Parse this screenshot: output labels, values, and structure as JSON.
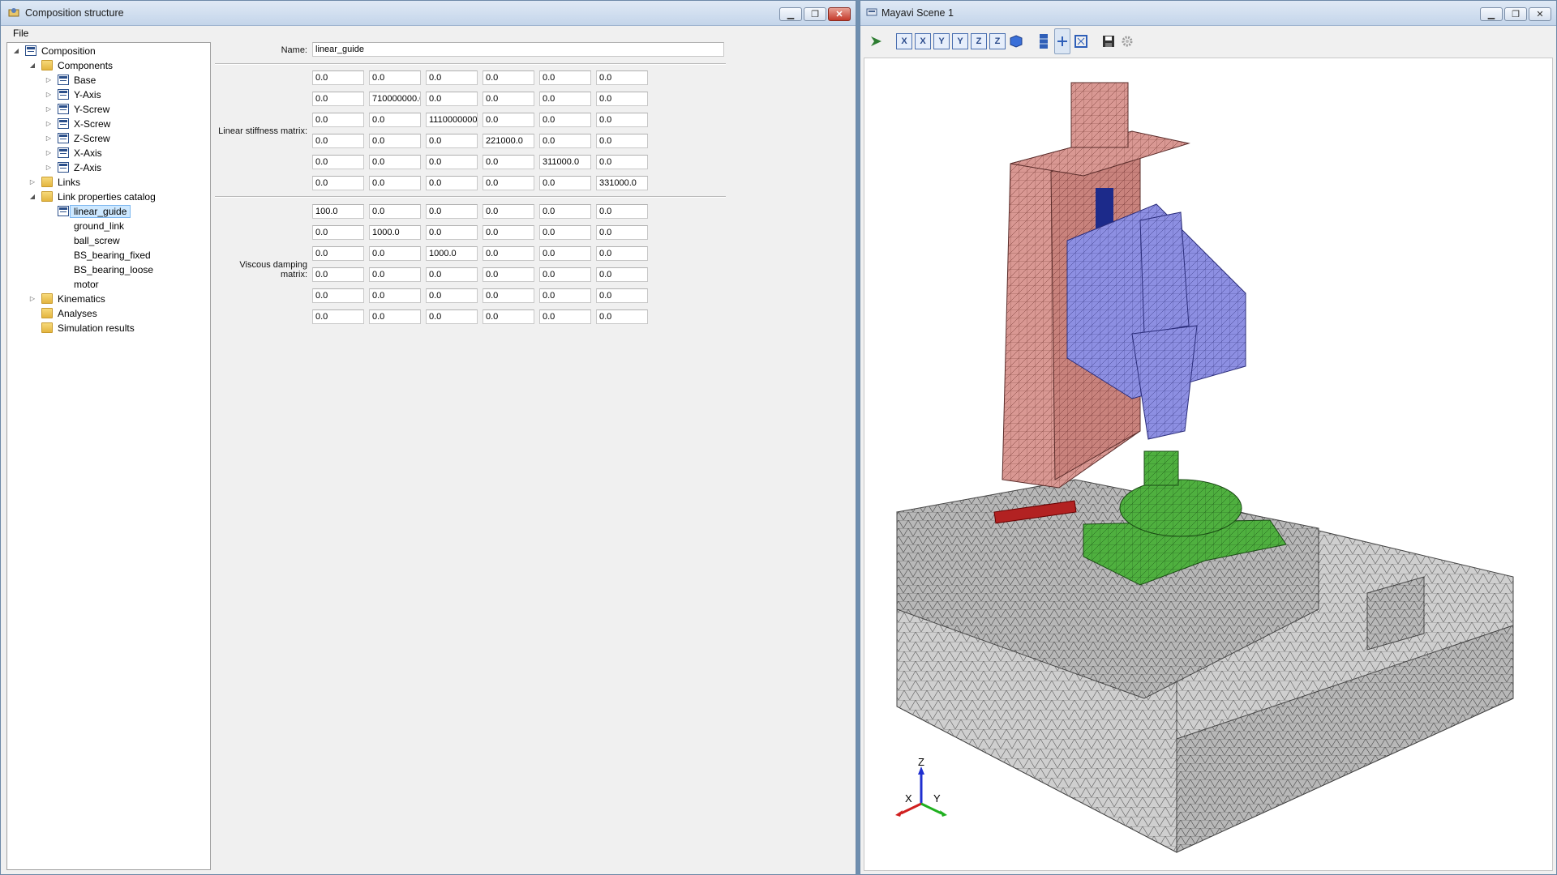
{
  "left_window": {
    "title": "Composition structure",
    "menu": {
      "file": "File"
    },
    "tree": {
      "root": "Composition",
      "components_folder": "Components",
      "components": [
        "Base",
        "Y-Axis",
        "Y-Screw",
        "X-Screw",
        "Z-Screw",
        "X-Axis",
        "Z-Axis"
      ],
      "links": "Links",
      "catalog_folder": "Link properties catalog",
      "catalog_items": [
        "linear_guide",
        "ground_link",
        "ball_screw",
        "BS_bearing_fixed",
        "BS_bearing_loose",
        "motor"
      ],
      "kinematics": "Kinematics",
      "analyses": "Analyses",
      "simulation_results": "Simulation results"
    },
    "form": {
      "name_label": "Name:",
      "name_value": "linear_guide",
      "stiffness_label": "Linear stiffness matrix:",
      "stiffness": [
        [
          "0.0",
          "0.0",
          "0.0",
          "0.0",
          "0.0",
          "0.0"
        ],
        [
          "0.0",
          "710000000.0",
          "0.0",
          "0.0",
          "0.0",
          "0.0"
        ],
        [
          "0.0",
          "0.0",
          "1110000000.0",
          "0.0",
          "0.0",
          "0.0"
        ],
        [
          "0.0",
          "0.0",
          "0.0",
          "221000.0",
          "0.0",
          "0.0"
        ],
        [
          "0.0",
          "0.0",
          "0.0",
          "0.0",
          "311000.0",
          "0.0"
        ],
        [
          "0.0",
          "0.0",
          "0.0",
          "0.0",
          "0.0",
          "331000.0"
        ]
      ],
      "damping_label": "Viscous damping matrix:",
      "damping": [
        [
          "100.0",
          "0.0",
          "0.0",
          "0.0",
          "0.0",
          "0.0"
        ],
        [
          "0.0",
          "1000.0",
          "0.0",
          "0.0",
          "0.0",
          "0.0"
        ],
        [
          "0.0",
          "0.0",
          "1000.0",
          "0.0",
          "0.0",
          "0.0"
        ],
        [
          "0.0",
          "0.0",
          "0.0",
          "0.0",
          "0.0",
          "0.0"
        ],
        [
          "0.0",
          "0.0",
          "0.0",
          "0.0",
          "0.0",
          "0.0"
        ],
        [
          "0.0",
          "0.0",
          "0.0",
          "0.0",
          "0.0",
          "0.0"
        ]
      ]
    }
  },
  "right_window": {
    "title": "Mayavi Scene 1",
    "toolbar": {
      "axis_buttons": [
        "X",
        "X",
        "Y",
        "Y",
        "Z",
        "Z"
      ]
    },
    "scene": {
      "axes_labels": {
        "x": "X",
        "y": "Y",
        "z": "Z"
      },
      "colors": {
        "column": "#d79a96",
        "spindle_head": "#8c8ee0",
        "table": "#4caf3e",
        "base": "#c9c9c9",
        "screw": "#b22222"
      }
    }
  }
}
